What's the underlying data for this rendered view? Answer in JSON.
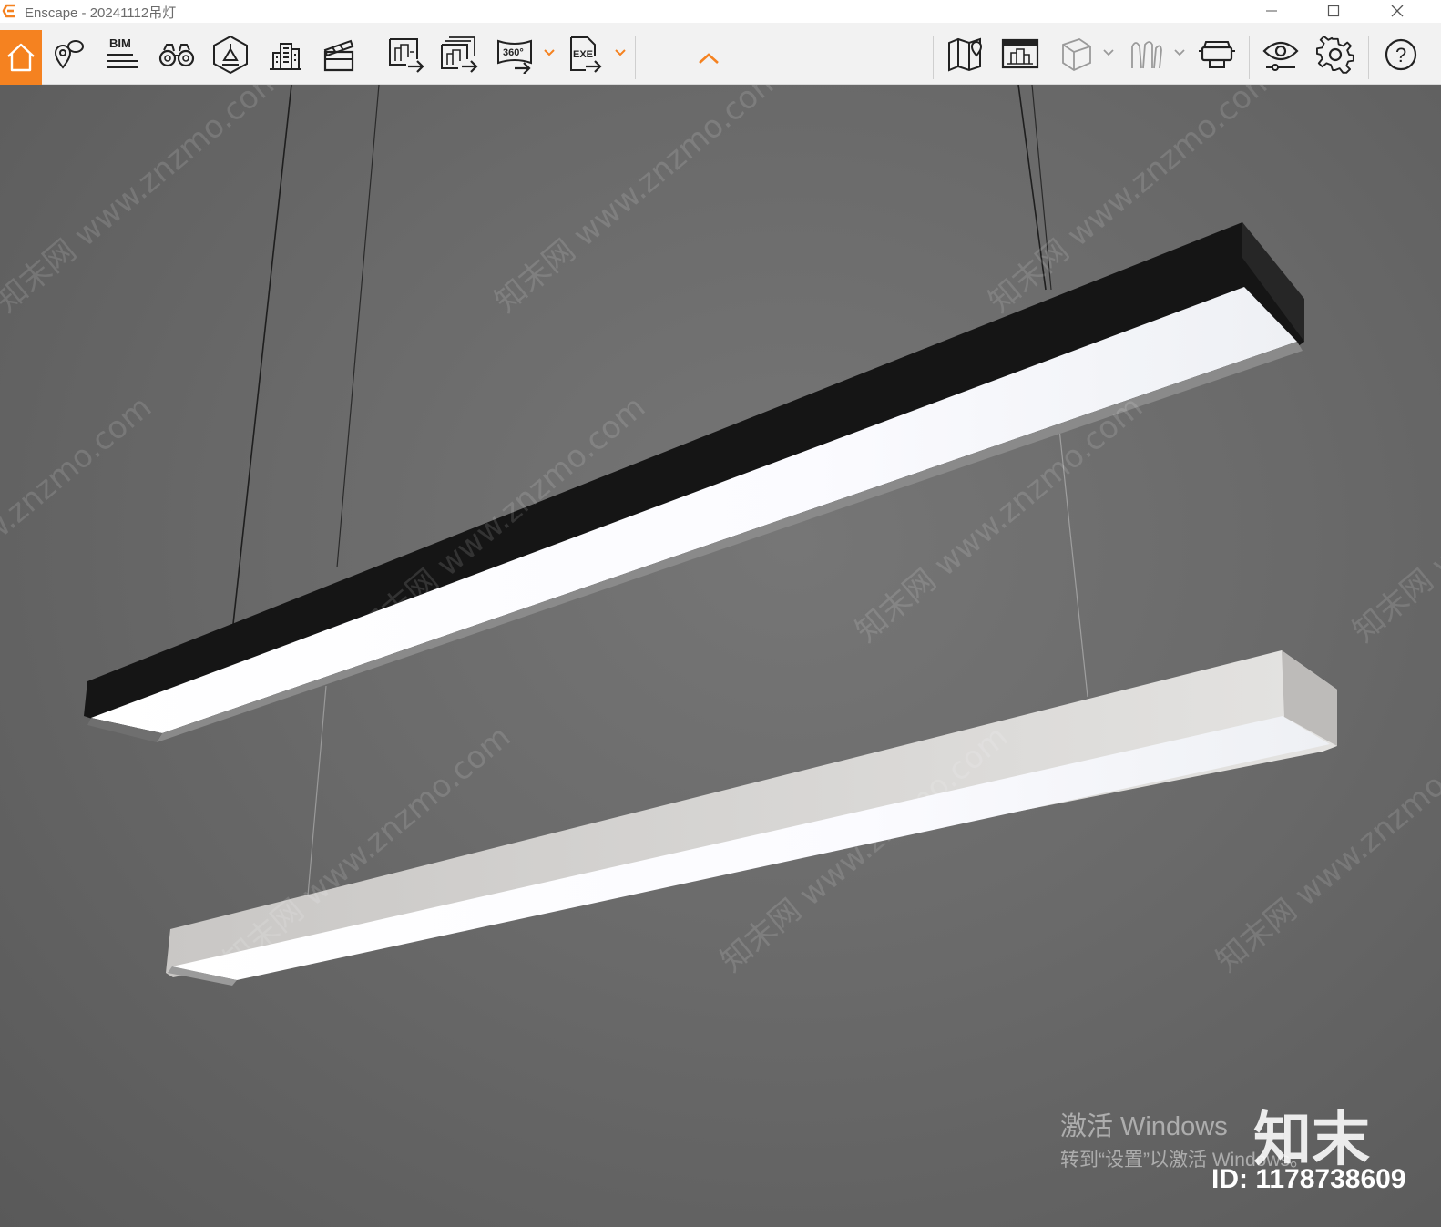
{
  "window": {
    "title": "Enscape - 20241112吊灯",
    "controls": {
      "minimize_icon": "minimize-icon",
      "maximize_icon": "maximize-icon",
      "close_icon": "close-icon"
    }
  },
  "toolbar": {
    "accent": "#f58220",
    "home": {
      "icon": "home-icon",
      "active": true
    },
    "bim_label": "BIM",
    "left_group": [
      {
        "icon": "views-pin-icon"
      },
      {
        "icon": "bim-list-icon"
      },
      {
        "icon": "binoculars-icon"
      },
      {
        "icon": "light-view-icon"
      },
      {
        "icon": "asset-library-icon"
      },
      {
        "icon": "video-editor-icon"
      }
    ],
    "export_group": [
      {
        "icon": "render-screenshot-icon"
      },
      {
        "icon": "batch-render-icon"
      },
      {
        "icon": "panorama-360-icon",
        "label": "360°",
        "has_dropdown": true
      },
      {
        "icon": "exe-export-icon",
        "label": "EXE",
        "has_dropdown": true
      }
    ],
    "collapse_icon": "chevron-up-icon",
    "right_group": [
      {
        "icon": "map-icon"
      },
      {
        "icon": "screenshot-gallery-icon"
      },
      {
        "icon": "cube-view-icon",
        "has_dropdown": true
      },
      {
        "icon": "walk-figure-icon",
        "has_dropdown": true
      },
      {
        "icon": "vr-headset-icon"
      },
      {
        "icon": "visual-settings-icon"
      },
      {
        "icon": "settings-gear-icon"
      },
      {
        "icon": "help-icon",
        "label": "?"
      }
    ]
  },
  "viewport": {
    "scene": "two linear pendant lights",
    "watermark_text": "知末网 www.znzmo.com",
    "activation": {
      "line1": "激活 Windows",
      "line2": "转到“设置”以激活 Windows。"
    },
    "brand": "知末",
    "id_label": "ID: 1178738609"
  }
}
